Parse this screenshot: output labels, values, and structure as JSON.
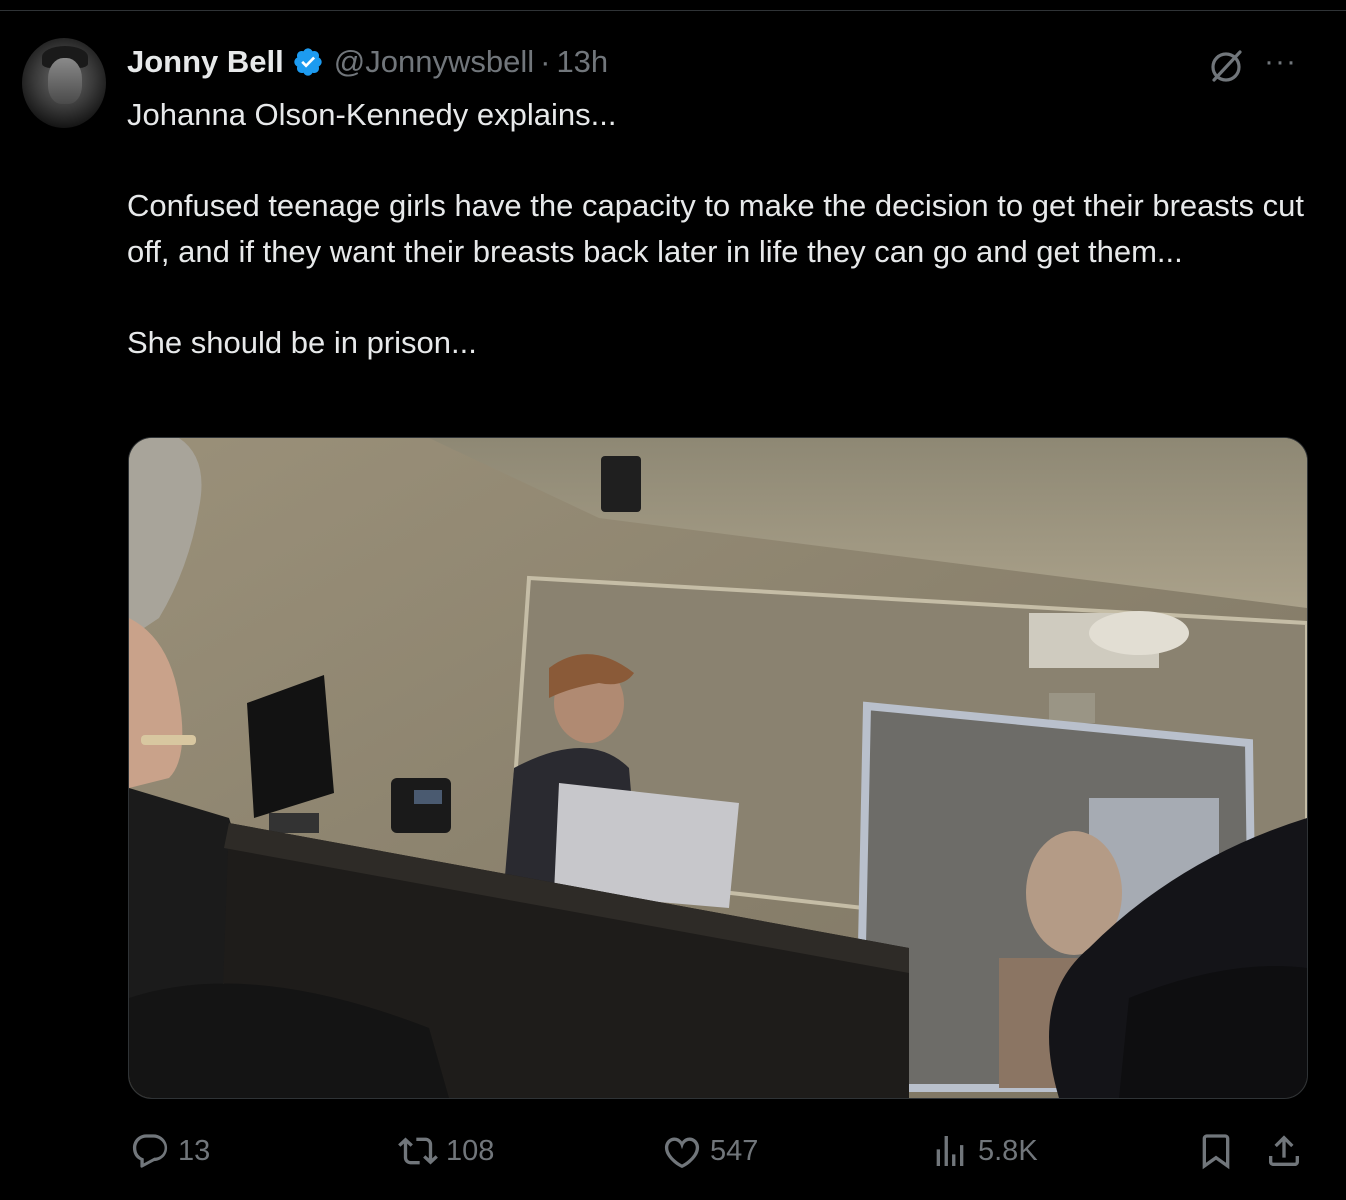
{
  "tweet": {
    "author_name": "Jonny Bell",
    "handle": "@Jonnywsbell",
    "separator": "·",
    "time": "13h",
    "paragraphs": [
      "Johanna Olson-Kennedy explains...",
      "Confused teenage girls have the capacity to make the decision to get their breasts cut off, and if they want their breasts back later in life they can go and get them...",
      "She should be in prison..."
    ],
    "verified_badge": "verified-badge-icon",
    "accent_color": "#1d9bf0"
  },
  "actions": {
    "replies": "13",
    "reposts": "108",
    "likes": "547",
    "views": "5.8K"
  },
  "icons": [
    "avatar",
    "verified-badge-icon",
    "grok-icon",
    "more-icon",
    "reply-icon",
    "repost-icon",
    "like-icon",
    "views-icon",
    "bookmark-icon",
    "share-icon"
  ]
}
